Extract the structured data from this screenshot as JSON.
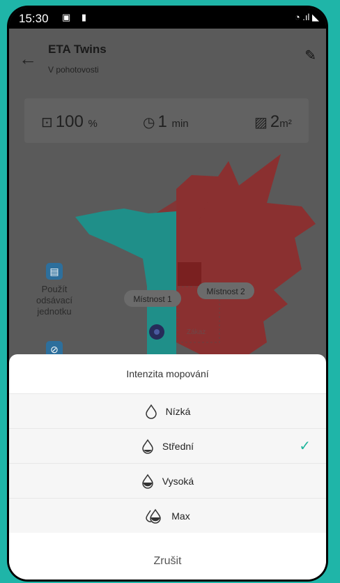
{
  "status_bar": {
    "time": "15:30",
    "left_icons": "▣ ▮",
    "right_icons": "◔ .ıl ◣"
  },
  "app_bar": {
    "title": "ETA Twins",
    "subtitle": "V pohotovosti",
    "back_icon": "←",
    "edit_icon": "✎"
  },
  "stats": [
    {
      "icon": "battery-icon",
      "glyph": "⊡",
      "value": "100",
      "unit": "%"
    },
    {
      "icon": "clock-icon",
      "glyph": "◷",
      "value": "1",
      "unit": "min"
    },
    {
      "icon": "area-icon",
      "glyph": "▨",
      "value": "2",
      "unit": "m²"
    }
  ],
  "map": {
    "rooms": [
      "Místnost 1",
      "Místnost 2"
    ],
    "zone_label": "Zákaz",
    "colors": {
      "room1": "#1f8f89",
      "room2": "#8a3030"
    }
  },
  "side_buttons": [
    {
      "label_lines": [
        "Použít",
        "odsávací",
        "jednotku"
      ],
      "icon": "dock-icon"
    },
    {
      "label_lines": [],
      "icon": "no-entry-icon"
    }
  ],
  "sheet": {
    "title": "Intenzita mopování",
    "options": [
      {
        "label": "Nízká",
        "selected": false,
        "level": 0
      },
      {
        "label": "Střední",
        "selected": true,
        "level": 1
      },
      {
        "label": "Vysoká",
        "selected": false,
        "level": 2
      },
      {
        "label": "Max",
        "selected": false,
        "level": 3
      }
    ],
    "cancel_label": "Zrušit",
    "accent_color": "#1fb59c"
  }
}
